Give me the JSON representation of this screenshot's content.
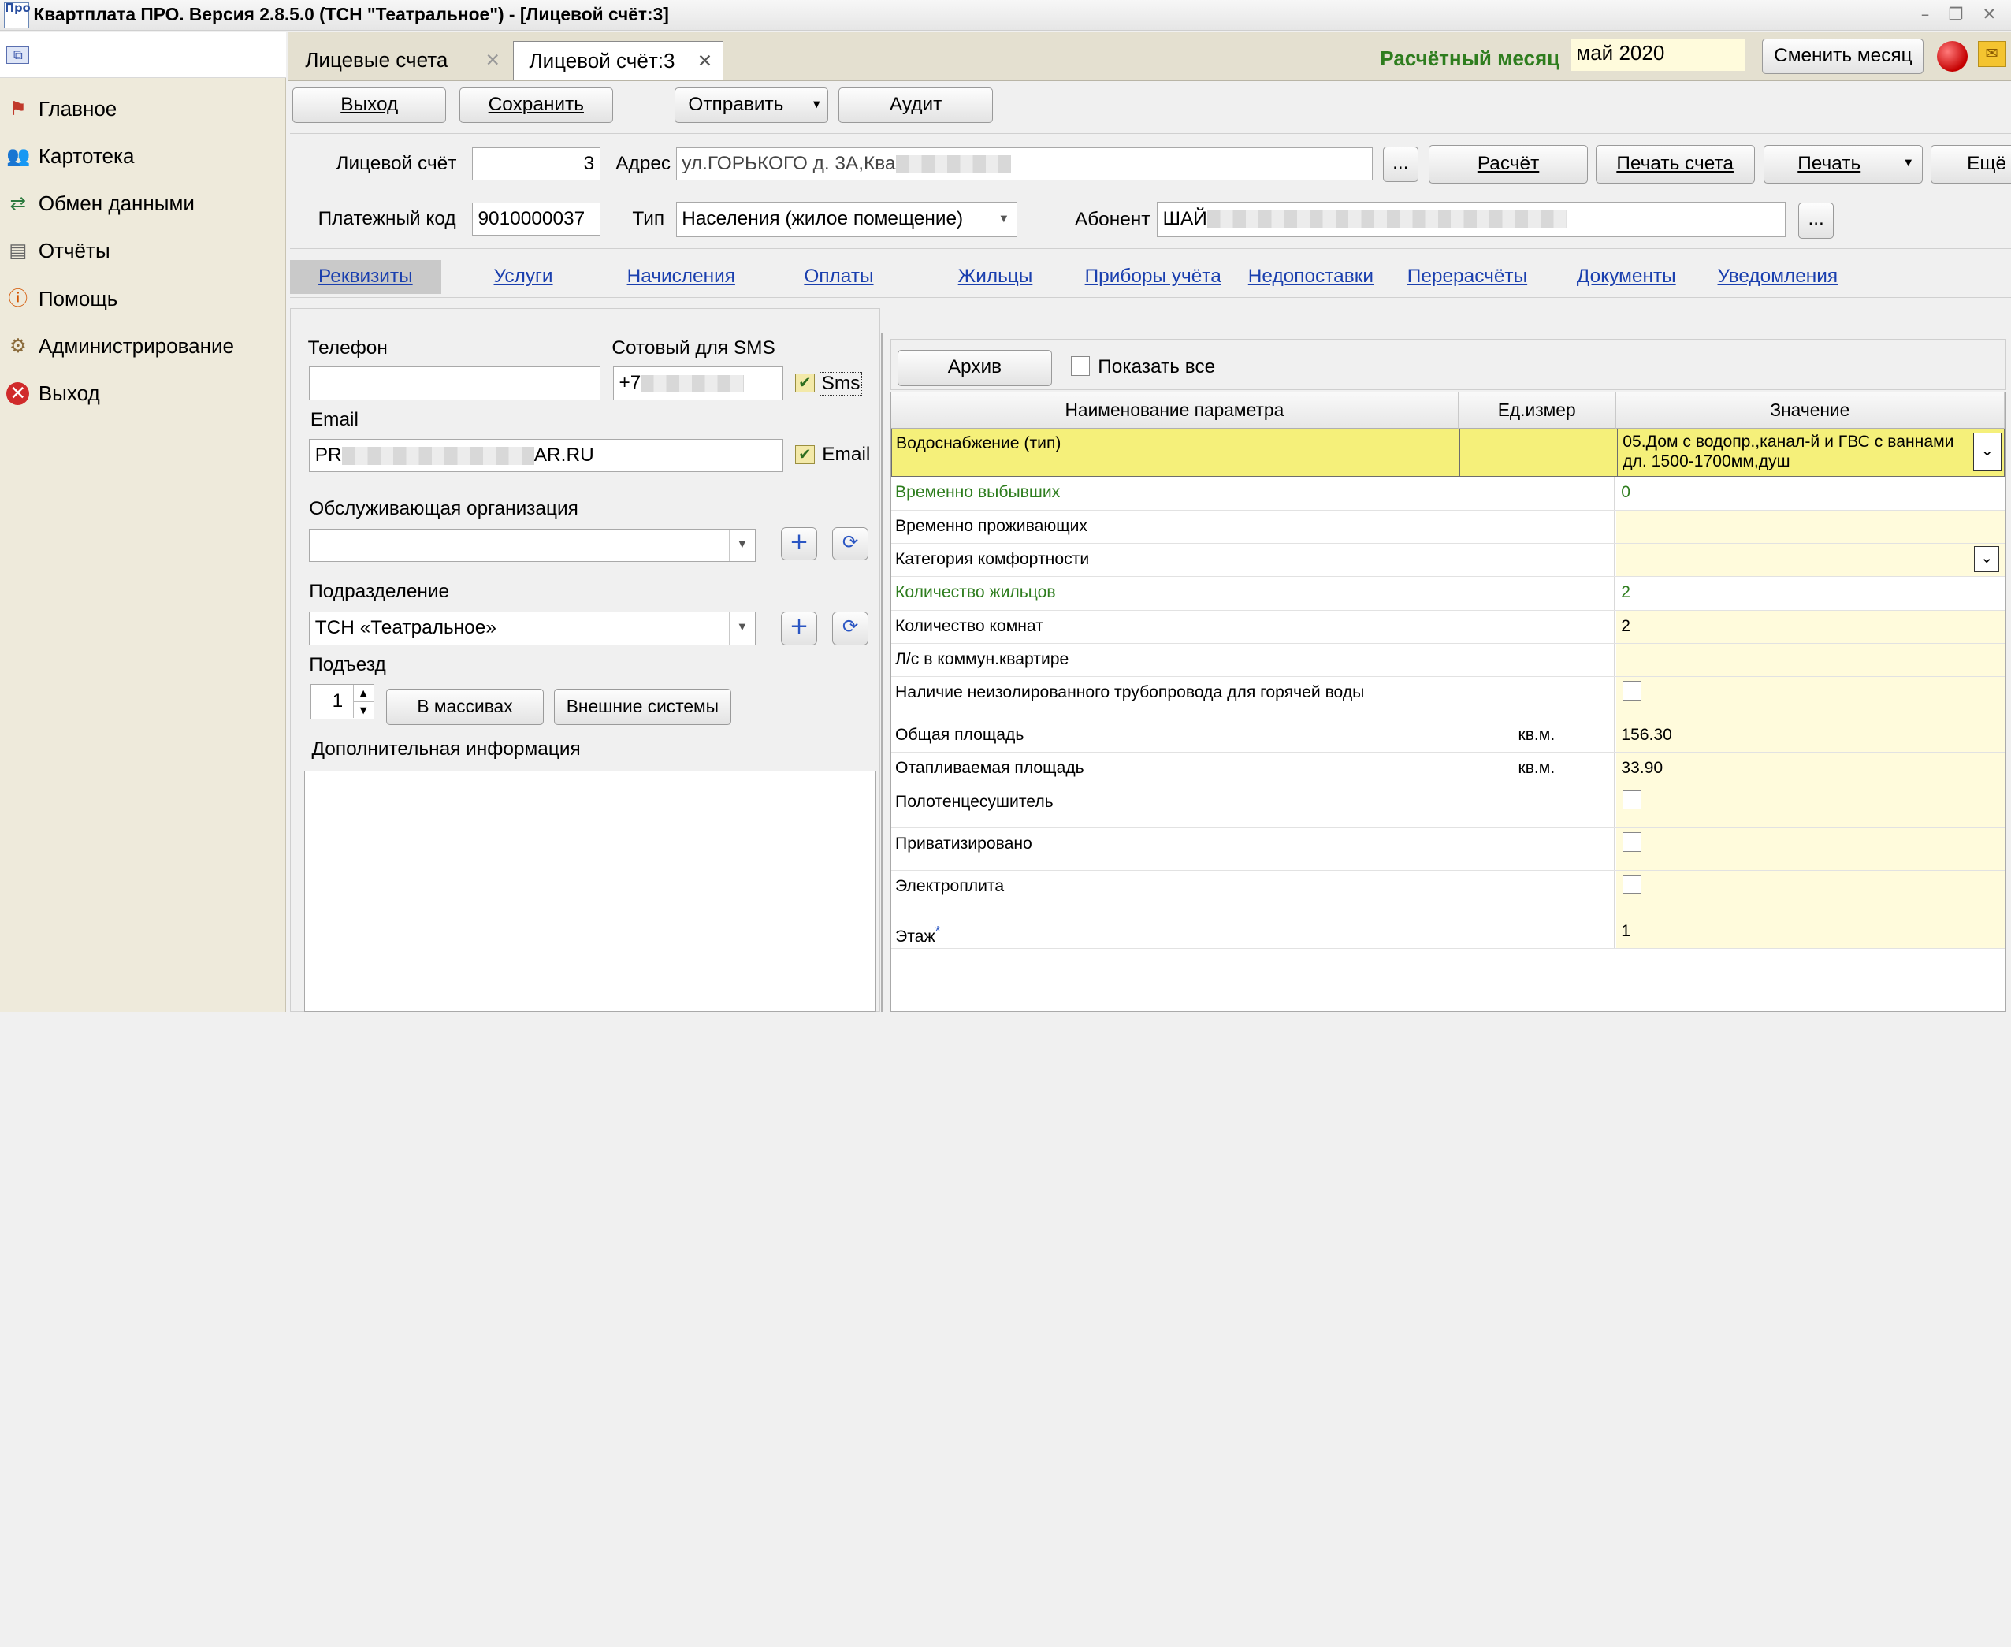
{
  "window": {
    "title": "Квартплата ПРО.  Версия 2.8.5.0 (ТСН \"Театральное\") - [Лицевой счёт:3]",
    "icon_text": "Про"
  },
  "sidebar": {
    "items": [
      {
        "label": "Главное",
        "icon": "flag-icon"
      },
      {
        "label": "Картотека",
        "icon": "people-icon"
      },
      {
        "label": "Обмен данными",
        "icon": "exchange-icon"
      },
      {
        "label": "Отчёты",
        "icon": "report-icon"
      },
      {
        "label": "Помощь",
        "icon": "help-icon"
      },
      {
        "label": "Администрирование",
        "icon": "admin-icon"
      },
      {
        "label": "Выход",
        "icon": "exit-icon"
      }
    ]
  },
  "tabs": [
    {
      "label": "Лицевые счета"
    },
    {
      "label": "Лицевой счёт:3"
    }
  ],
  "period": {
    "label": "Расчётный месяц",
    "value": "май 2020",
    "change_button": "Сменить месяц"
  },
  "toolbar": {
    "exit": "Выход",
    "save": "Сохранить",
    "send": "Отправить",
    "audit": "Аудит"
  },
  "account": {
    "account_label": "Лицевой счёт",
    "account_value": "3",
    "address_label": "Адрес",
    "address_value": "ул.ГОРЬКОГО д. 3А,Ква",
    "calc_button": "Расчёт",
    "print_invoice_button": "Печать счета",
    "print_button": "Печать",
    "more_button": "Ещё",
    "pay_code_label": "Платежный код",
    "pay_code_value": "9010000037",
    "type_label": "Тип",
    "type_value": "Населения (жилое помещение)",
    "subscriber_label": "Абонент",
    "subscriber_value": "ШАЙ",
    "ellipsis": "..."
  },
  "subtabs": [
    "Реквизиты",
    "Услуги",
    "Начисления",
    "Оплаты",
    "Жильцы",
    "Приборы учёта",
    "Недопоставки",
    "Перерасчёты",
    "Документы",
    "Уведомления"
  ],
  "details": {
    "phone_label": "Телефон",
    "phone_value": "",
    "sms_label": "Сотовый для SMS",
    "sms_value": "+7",
    "sms_check_label": "Sms",
    "email_label": "Email",
    "email_value_start": "PR",
    "email_value_end": "AR.RU",
    "email_check_label": "Email",
    "org_label": "Обслуживающая организация",
    "org_value": "",
    "division_label": "Подразделение",
    "division_value": "ТСН «Театральное»",
    "entrance_label": "Подъезд",
    "entrance_value": "1",
    "arrays_button": "В массивах",
    "external_button": "Внешние системы",
    "extra_label": "Дополнительная информация"
  },
  "params": {
    "archive_button": "Архив",
    "show_all_label": "Показать все",
    "headers": [
      "Наименование параметра",
      "Ед.измер",
      "Значение"
    ],
    "rows": [
      {
        "name": "Водоснабжение (тип)",
        "unit": "",
        "value": "05.Дом с водопр.,канал-й и ГВС с ваннами дл. 1500-1700мм,душ"
      },
      {
        "name": "Временно выбывших",
        "unit": "",
        "value": "0"
      },
      {
        "name": "Временно проживающих",
        "unit": "",
        "value": ""
      },
      {
        "name": "Категория комфортности",
        "unit": "",
        "value": ""
      },
      {
        "name": "Количество жильцов",
        "unit": "",
        "value": "2"
      },
      {
        "name": "Количество комнат",
        "unit": "",
        "value": "2"
      },
      {
        "name": "Л/с в коммун.квартире",
        "unit": "",
        "value": ""
      },
      {
        "name": "Наличие неизолированного трубопровода для горячей воды",
        "unit": "",
        "value": ""
      },
      {
        "name": "Общая площадь",
        "unit": "кв.м.",
        "value": "156.30"
      },
      {
        "name": "Отапливаемая площадь",
        "unit": "кв.м.",
        "value": "33.90"
      },
      {
        "name": "Полотенцесушитель",
        "unit": "",
        "value": ""
      },
      {
        "name": "Приватизировано",
        "unit": "",
        "value": ""
      },
      {
        "name": "Электроплита",
        "unit": "",
        "value": ""
      },
      {
        "name": "Этаж",
        "unit": "",
        "value": "1",
        "marker": "*"
      }
    ]
  },
  "colors": {
    "accent_green": "#2e7d1e",
    "link_blue": "#1a3fae",
    "highlight_yellow": "#f5f07a"
  }
}
